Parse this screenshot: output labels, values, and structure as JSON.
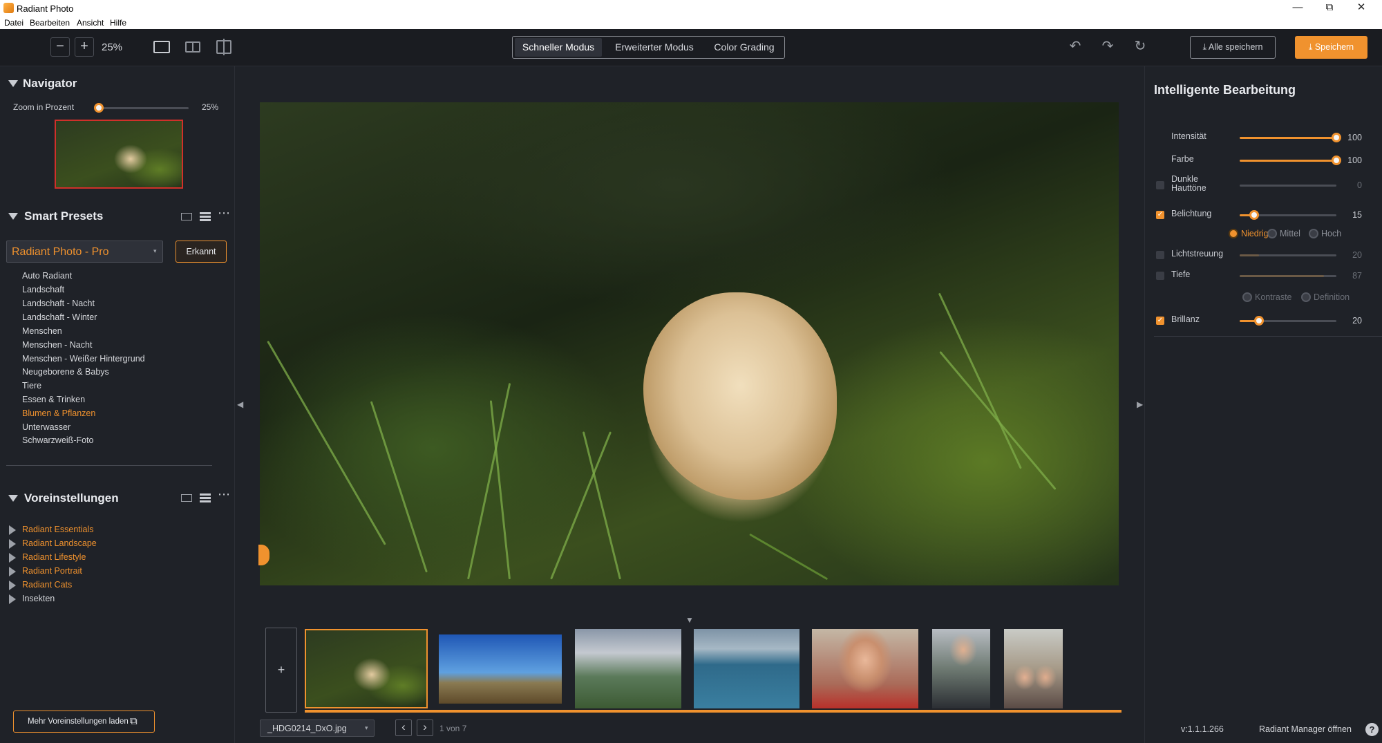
{
  "window": {
    "title": "Radiant Photo",
    "minimize": "—",
    "maximize": "⧉",
    "close": "✕"
  },
  "menu": [
    "Datei",
    "Bearbeiten",
    "Ansicht",
    "Hilfe"
  ],
  "toolbar": {
    "zoom_out": "−",
    "zoom_in": "+",
    "zoom_value": "25%",
    "modes": [
      "Schneller Modus",
      "Erweiterter Modus",
      "Color Grading"
    ],
    "active_mode": "Schneller Modus",
    "save_all_label": "Alle speichern",
    "save_label": "Speichern"
  },
  "navigator": {
    "title": "Navigator",
    "zoom_label": "Zoom in Prozent",
    "zoom_value": "25%",
    "zoom_fraction": 0.0
  },
  "smart_presets": {
    "title": "Smart Presets",
    "dropdown_value": "Radiant Photo - Pro",
    "badge": "Erkannt",
    "items": [
      "Auto Radiant",
      "Landschaft",
      "Landschaft - Nacht",
      "Landschaft - Winter",
      "Menschen",
      "Menschen - Nacht",
      "Menschen - Weißer Hintergrund",
      "Neugeborene & Babys",
      "Tiere",
      "Essen & Trinken",
      "Blumen & Pflanzen",
      "Unterwasser",
      "Schwarzweiß-Foto"
    ],
    "selected_index": 10
  },
  "voreinstellungen": {
    "title": "Voreinstellungen",
    "items": [
      {
        "label": "Radiant Essentials",
        "color": "#f0922e"
      },
      {
        "label": "Radiant Landscape",
        "color": "#f0922e"
      },
      {
        "label": "Radiant Lifestyle",
        "color": "#f0922e"
      },
      {
        "label": "Radiant Portrait",
        "color": "#f0922e"
      },
      {
        "label": "Radiant Cats",
        "color": "#f0922e"
      },
      {
        "label": "Insekten",
        "color": "#d6d8dc"
      }
    ],
    "load_more_label": "Mehr Voreinstellungen laden"
  },
  "filmstrip": {
    "add_label": "+",
    "current_file": "_HDG0214_DxO.jpg",
    "counter": "1 von 7",
    "prev": "‹",
    "next": "›"
  },
  "smart_edit": {
    "title": "Intelligente Bearbeitung",
    "sliders": [
      {
        "label": "Intensität",
        "value": "100",
        "fraction": 1.0,
        "checkbox": "none",
        "enabled": true
      },
      {
        "label": "Farbe",
        "value": "100",
        "fraction": 1.0,
        "checkbox": "none",
        "enabled": true
      },
      {
        "label": "Dunkle Hauttöne",
        "value": "0",
        "fraction": 0.0,
        "checkbox": "off",
        "enabled": false
      },
      {
        "label": "Belichtung",
        "value": "15",
        "fraction": 0.15,
        "checkbox": "on",
        "enabled": true
      },
      {
        "label": "Lichtstreuung",
        "value": "20",
        "fraction": 0.2,
        "checkbox": "off",
        "enabled": false
      },
      {
        "label": "Tiefe",
        "value": "87",
        "fraction": 0.87,
        "checkbox": "off",
        "enabled": false
      },
      {
        "label": "Brillanz",
        "value": "20",
        "fraction": 0.2,
        "checkbox": "on",
        "enabled": true
      }
    ],
    "exposure_options": [
      "Niedrig",
      "Mittel",
      "Hoch"
    ],
    "exposure_selected": "Niedrig",
    "depth_options": [
      "Kontraste",
      "Definition"
    ]
  },
  "footer": {
    "version": "v:1.1.1.266",
    "manager_label": "Radiant Manager öffnen",
    "help": "?"
  },
  "colors": {
    "accent": "#f0922e",
    "bg": "#1f2228",
    "toolbar": "#1a1c21"
  }
}
